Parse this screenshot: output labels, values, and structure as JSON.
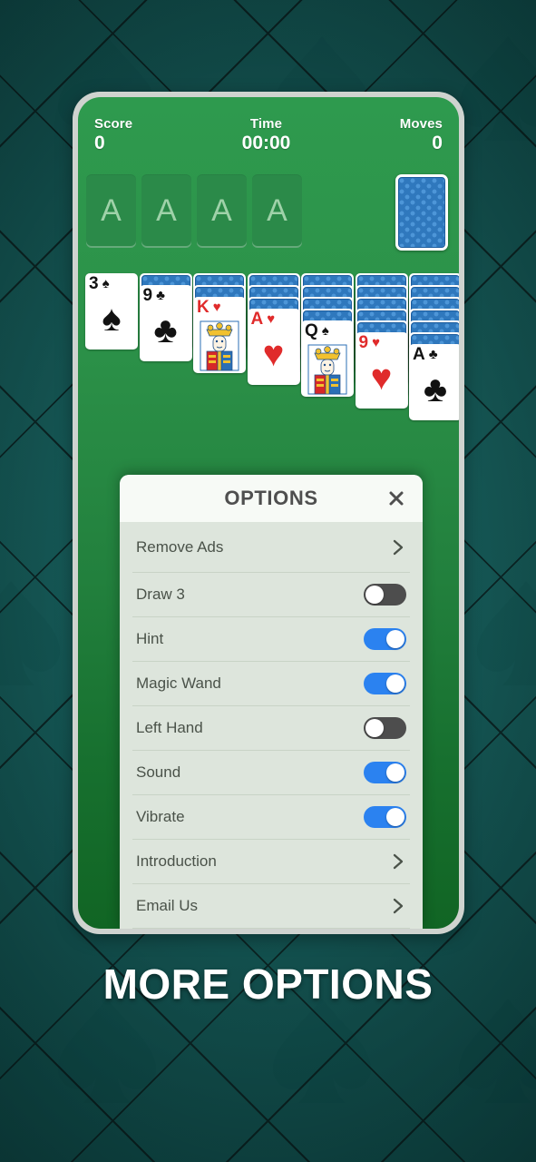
{
  "background": {
    "base_color": "#12504e",
    "line_color": "#0a1c1c",
    "watermark_suits": [
      "spade",
      "heart",
      "club",
      "diamond"
    ]
  },
  "game": {
    "hud": {
      "score_label": "Score",
      "score_value": "0",
      "time_label": "Time",
      "time_value": "00:00",
      "moves_label": "Moves",
      "moves_value": "0"
    },
    "foundations": [
      {
        "placeholder": "A"
      },
      {
        "placeholder": "A"
      },
      {
        "placeholder": "A"
      },
      {
        "placeholder": "A"
      }
    ],
    "stock": {
      "name": "stock-pile",
      "face_down": true
    },
    "table_felt_color": "#2c9249",
    "tableau": [
      {
        "facedown": 0,
        "face": {
          "rank": "3",
          "suit": "spade",
          "color": "black",
          "symbol": "♠"
        }
      },
      {
        "facedown": 1,
        "face": {
          "rank": "9",
          "suit": "club",
          "color": "black",
          "symbol": "♣"
        }
      },
      {
        "facedown": 2,
        "face": {
          "rank": "K",
          "suit": "heart",
          "color": "red",
          "symbol": "♥"
        }
      },
      {
        "facedown": 3,
        "face": {
          "rank": "A",
          "suit": "heart",
          "color": "red",
          "symbol": "♥"
        }
      },
      {
        "facedown": 4,
        "face": {
          "rank": "Q",
          "suit": "spade",
          "color": "black",
          "symbol": "♠"
        }
      },
      {
        "facedown": 5,
        "face": {
          "rank": "9",
          "suit": "heart",
          "color": "red",
          "symbol": "♥"
        }
      },
      {
        "facedown": 6,
        "face": {
          "rank": "A",
          "suit": "club",
          "color": "black",
          "symbol": "♣"
        }
      }
    ]
  },
  "dialog": {
    "title": "OPTIONS",
    "close_icon": "close-icon",
    "items": [
      {
        "label": "Remove Ads",
        "type": "link",
        "icon": "chevron-right-icon"
      },
      {
        "label": "Draw 3",
        "type": "toggle",
        "state": "off"
      },
      {
        "label": "Hint",
        "type": "toggle",
        "state": "on"
      },
      {
        "label": "Magic Wand",
        "type": "toggle",
        "state": "on"
      },
      {
        "label": "Left Hand",
        "type": "toggle",
        "state": "off"
      },
      {
        "label": "Sound",
        "type": "toggle",
        "state": "on"
      },
      {
        "label": "Vibrate",
        "type": "toggle",
        "state": "on"
      },
      {
        "label": "Introduction",
        "type": "link",
        "icon": "chevron-right-icon"
      },
      {
        "label": "Email Us",
        "type": "link",
        "icon": "chevron-right-icon"
      }
    ],
    "toggle_on_color": "#2b82f0",
    "toggle_off_color": "#4d4d4d",
    "background_color": "#dde5dc",
    "header_color": "#f7faf6"
  },
  "banner": {
    "text": "MORE OPTIONS"
  }
}
